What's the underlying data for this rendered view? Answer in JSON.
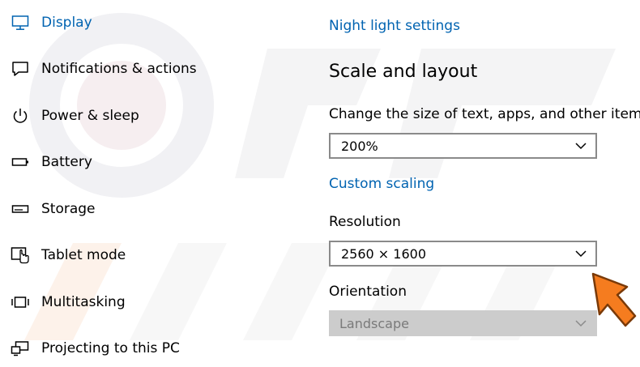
{
  "sidebar": {
    "items": [
      {
        "label": "Display",
        "icon": "monitor-icon",
        "active": true
      },
      {
        "label": "Notifications & actions",
        "icon": "notification-icon",
        "active": false
      },
      {
        "label": "Power & sleep",
        "icon": "power-icon",
        "active": false
      },
      {
        "label": "Battery",
        "icon": "battery-icon",
        "active": false
      },
      {
        "label": "Storage",
        "icon": "storage-icon",
        "active": false
      },
      {
        "label": "Tablet mode",
        "icon": "tablet-mode-icon",
        "active": false
      },
      {
        "label": "Multitasking",
        "icon": "multitasking-icon",
        "active": false
      },
      {
        "label": "Projecting to this PC",
        "icon": "projecting-icon",
        "active": false
      }
    ]
  },
  "main": {
    "night_light_link": "Night light settings",
    "section_title": "Scale and layout",
    "scale": {
      "label": "Change the size of text, apps, and other items",
      "value": "200%"
    },
    "custom_scaling_link": "Custom scaling",
    "resolution": {
      "label": "Resolution",
      "value": "2560 × 1600"
    },
    "orientation": {
      "label": "Orientation",
      "value": "Landscape",
      "disabled": true
    }
  },
  "colors": {
    "accent": "#0063b1",
    "arrow": "#f57c1f",
    "disabled_bg": "#cccccc"
  }
}
